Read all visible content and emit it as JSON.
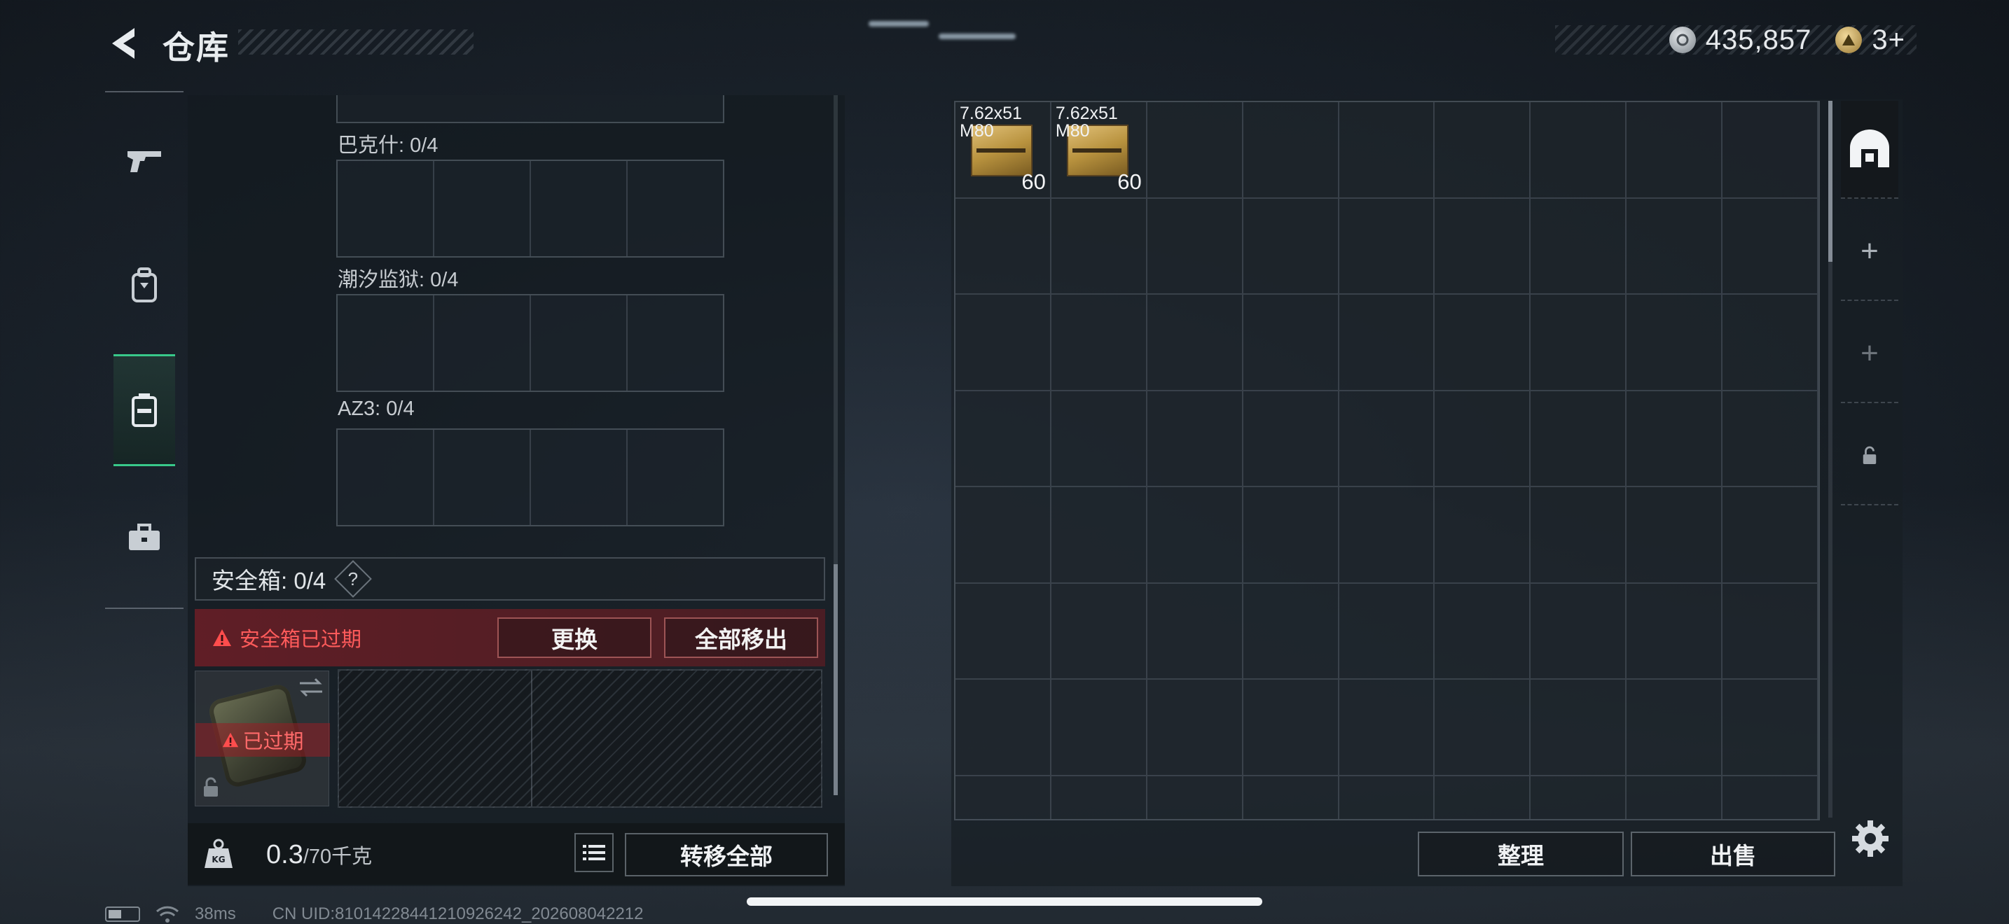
{
  "header": {
    "title": "仓库"
  },
  "currency": [
    {
      "icon": "silver-coin-icon",
      "value": "435,857"
    },
    {
      "icon": "gold-triangle-coin-icon",
      "value": "3+"
    }
  ],
  "leftnav": {
    "items": [
      {
        "icon": "pistol-icon",
        "active": false
      },
      {
        "icon": "backpack-icon",
        "active": false
      },
      {
        "icon": "container-icon",
        "active": true
      },
      {
        "icon": "briefcase-icon",
        "active": false
      }
    ]
  },
  "loadout": {
    "slots": [
      {
        "label": "巴克什: 0/4"
      },
      {
        "label": "潮汐监狱: 0/4"
      },
      {
        "label": "AZ3: 0/4"
      }
    ]
  },
  "safebox": {
    "label": "安全箱: 0/4",
    "help": "?",
    "expired_warning": "安全箱已过期",
    "replace_button": "更换",
    "remove_all_button": "全部移出",
    "thumb_expired": "已过期"
  },
  "footer_left": {
    "weight_current": "0.3",
    "weight_max": "/70千克",
    "transfer_all": "转移全部"
  },
  "storage": {
    "columns": 9,
    "rows": 8,
    "items": [
      {
        "name_line1": "7.62x51",
        "name_line2": "M80",
        "count": "60"
      },
      {
        "name_line1": "7.62x51",
        "name_line2": "M80",
        "count": "60"
      }
    ],
    "sort_button": "整理",
    "sell_button": "出售"
  },
  "side_tabs": [
    {
      "icon": "storage-tab-icon",
      "active": true
    },
    {
      "icon": "plus-icon",
      "active": false
    },
    {
      "icon": "plus-icon",
      "active": false
    },
    {
      "icon": "lock-icon",
      "active": false
    }
  ],
  "statusbar": {
    "ping": "38ms",
    "uid": "CN UID:810142284412109262​42_202608042212"
  }
}
